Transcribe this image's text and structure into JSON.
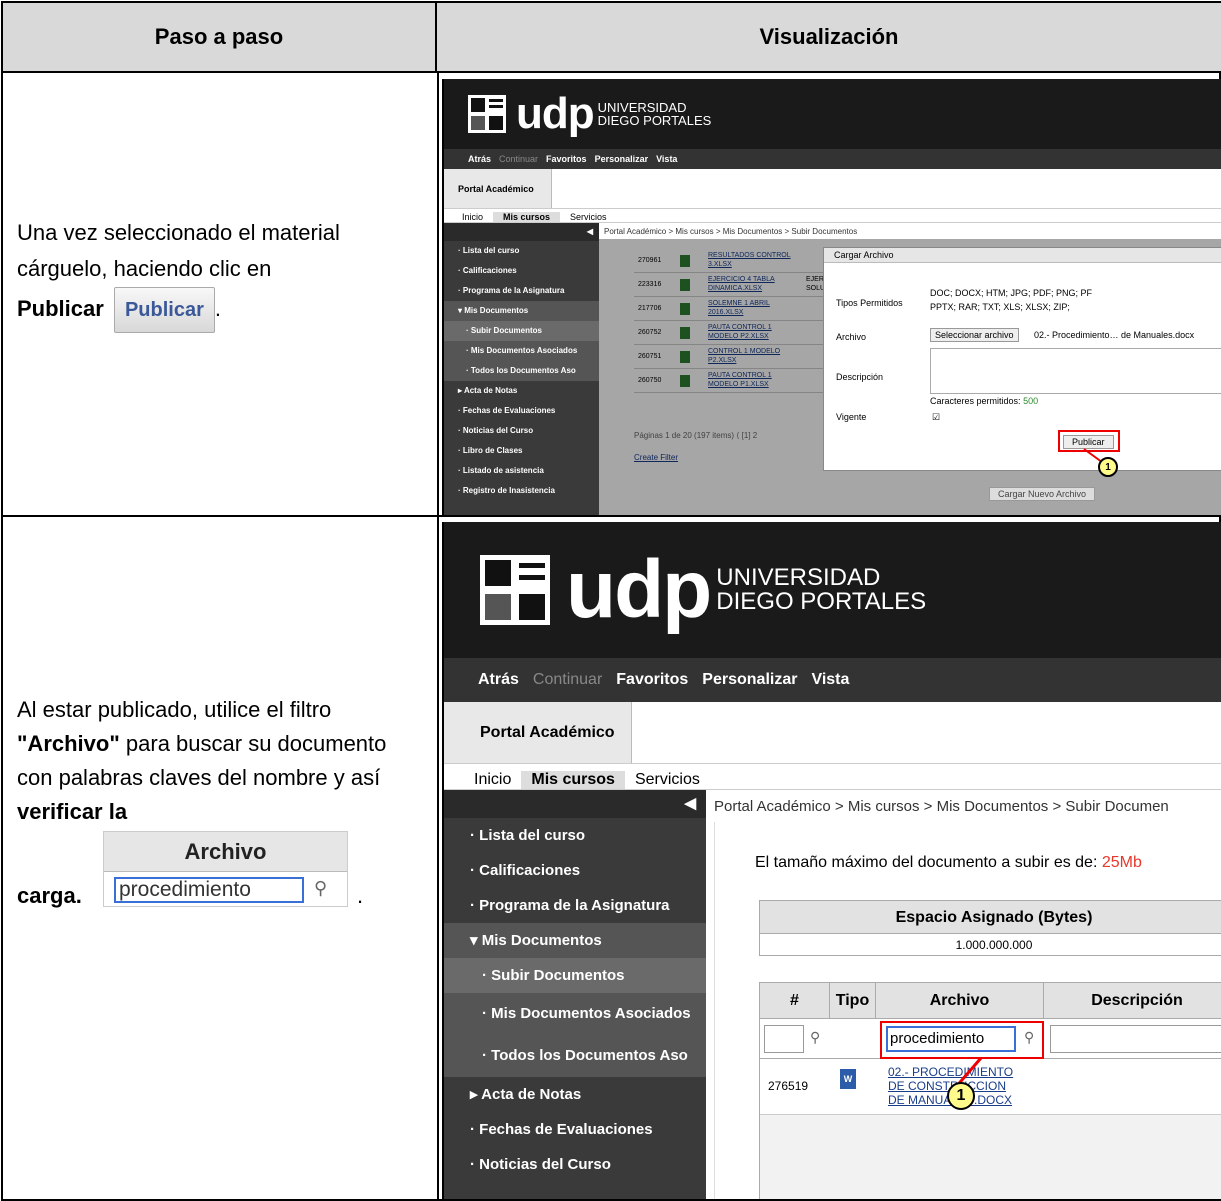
{
  "headers": {
    "col1": "Paso a paso",
    "col2": "Visualización"
  },
  "row1": {
    "text_a": "Una vez seleccionado el material cárguelo, haciendo clic en",
    "text_bold": "Publicar",
    "button_label": "Publicar",
    "period": "."
  },
  "row2": {
    "text_a": "Al estar publicado, utilice el filtro",
    "text_bold1": "\"Archivo\"",
    "text_b": "para buscar su documento con palabras claves del nombre y así",
    "text_bold2": "verificar la",
    "text_bold3": "carga.",
    "filter_header": "Archivo",
    "filter_value": "procedimiento",
    "period": "."
  },
  "portal": {
    "brand": "udp",
    "brand_line1": "UNIVERSIDAD",
    "brand_line2": "DIEGO PORTALES",
    "nav_back": "Atrás",
    "nav_continue": "Continuar",
    "nav_items": [
      "Favoritos",
      "Personalizar",
      "Vista"
    ],
    "portal_tab": "Portal Académico",
    "tabs": [
      "Inicio",
      "Mis cursos",
      "Servicios"
    ],
    "breadcrumb": "Portal Académico  >  Mis cursos  >  Mis Documentos  >  Subir Documentos",
    "breadcrumb2": "Portal Académico  >  Mis cursos  >  Mis Documentos  >  Subir Documen",
    "sidebar": [
      "Lista del curso",
      "Calificaciones",
      "Programa de la Asignatura",
      "Mis Documentos",
      "Subir Documentos",
      "Mis Documentos Asociados",
      "Todos los Documentos Aso",
      "Acta de Notas",
      "Fechas de Evaluaciones",
      "Noticias del Curso",
      "Libro de Clases",
      "Listado de asistencia",
      "Registro de Inasistencia"
    ]
  },
  "shot1": {
    "rows": [
      {
        "id": "270961",
        "name": "RESULTADOS CONTROL 3.XLSX",
        "desc": ""
      },
      {
        "id": "223316",
        "name": "EJERCICIO 4 TABLA DINAMICA.XLSX",
        "desc": "EJER SOLU"
      },
      {
        "id": "217706",
        "name": "SOLEMNE 1 ABRIL 2016.XLSX",
        "desc": ""
      },
      {
        "id": "260752",
        "name": "PAUTA CONTROL 1 MODELO P2.XLSX",
        "desc": ""
      },
      {
        "id": "260751",
        "name": "CONTROL 1 MODELO P2.XLSX",
        "desc": ""
      },
      {
        "id": "260750",
        "name": "PAUTA CONTROL 1 MODELO P1.XLSX",
        "desc": ""
      }
    ],
    "pager": "Páginas 1 de 20 (197 items)",
    "pager_page": "[1]",
    "pager_next": "2",
    "create_filter": "Create Filter",
    "dialog_title": "Cargar Archivo",
    "tipos_label": "Tipos Permitidos",
    "tipos_line1": "DOC;  DOCX;  HTM;  JPG;  PDF;  PNG;  PF",
    "tipos_line2": "PPTX;  RAR;  TXT;  XLS;  XLSX;  ZIP;",
    "archivo_label": "Archivo",
    "select_btn": "Seleccionar archivo",
    "file_name": "02.- Procedimiento… de Manuales.docx",
    "desc_label": "Descripción",
    "chars_label": "Caracteres permitidos:",
    "chars_value": "500",
    "vigente_label": "Vigente",
    "publicar_btn": "Publicar",
    "cargar_nuevo": "Cargar Nuevo Archivo",
    "callout": "1"
  },
  "shot2": {
    "max_size_label": "El tamaño máximo del documento a subir es de:",
    "max_size_value": "25Mb",
    "espacio_header": "Espacio Asignado (Bytes)",
    "espacio_value": "1.000.000.000",
    "cols": [
      "#",
      "Tipo",
      "Archivo",
      "Descripción"
    ],
    "filter_value": "procedimiento",
    "row_id": "276519",
    "row_name": "02.- PROCEDIMIENTO DE CONSTRUCCION DE MANUALES.DOCX",
    "row_name_l1": "02.- PROCEDIMIENTO",
    "row_name_l2": "DE CONSTRUCCION",
    "row_name_l3": "DE MANUALES.DOCX",
    "callout": "1"
  },
  "colors": {
    "red": "#e00000",
    "size_red": "#e8372b",
    "link": "#1a3d8a",
    "callout_fill": "#fffa8c"
  }
}
